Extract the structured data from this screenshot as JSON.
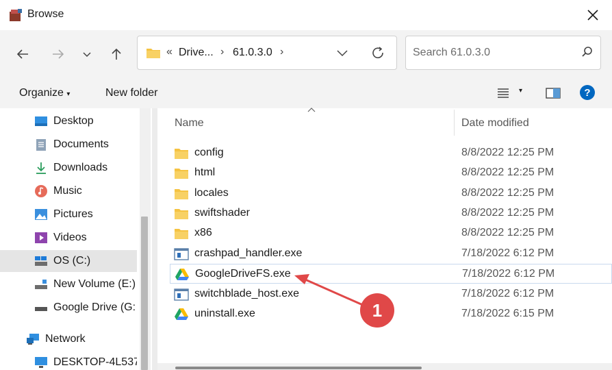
{
  "window": {
    "title": "Browse"
  },
  "address": {
    "overflow": "«",
    "segments": [
      "Drive...",
      "61.0.3.0"
    ]
  },
  "search": {
    "placeholder": "Search 61.0.3.0"
  },
  "toolbar": {
    "organize": "Organize",
    "new_folder": "New folder"
  },
  "sidebar": {
    "items": [
      {
        "label": "Desktop",
        "icon": "desktop-icon"
      },
      {
        "label": "Documents",
        "icon": "documents-icon"
      },
      {
        "label": "Downloads",
        "icon": "downloads-icon"
      },
      {
        "label": "Music",
        "icon": "music-icon"
      },
      {
        "label": "Pictures",
        "icon": "pictures-icon"
      },
      {
        "label": "Videos",
        "icon": "videos-icon"
      },
      {
        "label": "OS (C:)",
        "icon": "drive-icon",
        "selected": true
      },
      {
        "label": "New Volume (E:)",
        "icon": "drive-icon"
      },
      {
        "label": "Google Drive (G:",
        "icon": "drive-icon"
      },
      {
        "label": "Network",
        "icon": "network-icon"
      },
      {
        "label": "DESKTOP-4L537",
        "icon": "computer-icon"
      }
    ]
  },
  "columns": {
    "name": "Name",
    "date": "Date modified"
  },
  "files": [
    {
      "name": "config",
      "date": "8/8/2022 12:25 PM",
      "type": "folder"
    },
    {
      "name": "html",
      "date": "8/8/2022 12:25 PM",
      "type": "folder"
    },
    {
      "name": "locales",
      "date": "8/8/2022 12:25 PM",
      "type": "folder"
    },
    {
      "name": "swiftshader",
      "date": "8/8/2022 12:25 PM",
      "type": "folder"
    },
    {
      "name": "x86",
      "date": "8/8/2022 12:25 PM",
      "type": "folder"
    },
    {
      "name": "crashpad_handler.exe",
      "date": "7/18/2022 6:12 PM",
      "type": "exe"
    },
    {
      "name": "GoogleDriveFS.exe",
      "date": "7/18/2022 6:12 PM",
      "type": "gdrive",
      "highlighted": true
    },
    {
      "name": "switchblade_host.exe",
      "date": "7/18/2022 6:12 PM",
      "type": "exe"
    },
    {
      "name": "uninstall.exe",
      "date": "7/18/2022 6:15 PM",
      "type": "gdrive"
    }
  ],
  "annotation": {
    "number": "1",
    "color": "#e04848"
  },
  "colors": {
    "accent": "#0067c0",
    "folder": "#f5c342",
    "selection": "#e5e5e5"
  }
}
